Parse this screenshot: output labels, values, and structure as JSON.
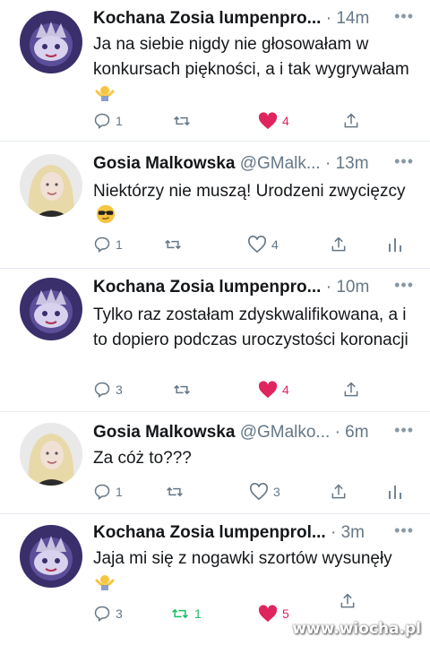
{
  "tweets": [
    {
      "name": "Kochana Zosia lumpenpro...",
      "handle": "",
      "time": "14m",
      "text": "Ja na siebie nigdy nie głosowałam w konkursach piękności, a i tak wygrywałam",
      "emoji": "shrug-emoji",
      "replies": "1",
      "retweets": "",
      "likes": "4",
      "liked": true,
      "avatar": "crowned-cat-avatar"
    },
    {
      "name": "Gosia Malkowska",
      "handle": "@GMalk...",
      "time": "13m",
      "text": "Niektórzy nie muszą! Urodzeni zwycięzcy",
      "emoji": "sunglasses-emoji",
      "replies": "1",
      "retweets": "",
      "likes": "4",
      "liked": false,
      "avatar": "woman-photo-avatar"
    },
    {
      "name": "Kochana Zosia lumpenpro...",
      "handle": "",
      "time": "10m",
      "text": "Tylko raz zostałam zdyskwalifikowana, a i to dopiero podczas uroczystości koronacji",
      "emoji": "",
      "replies": "3",
      "retweets": "",
      "likes": "4",
      "liked": true,
      "avatar": "crowned-cat-avatar"
    },
    {
      "name": "Gosia Malkowska",
      "handle": "@GMalko...",
      "time": "6m",
      "text": "Za cóż to???",
      "emoji": "",
      "replies": "1",
      "retweets": "",
      "likes": "3",
      "liked": false,
      "avatar": "woman-photo-avatar"
    },
    {
      "name": "Kochana Zosia lumpenprol...",
      "handle": "",
      "time": "3m",
      "text": "Jaja mi się z nogawki szortów wysunęły",
      "emoji": "shrug-emoji",
      "replies": "3",
      "retweets": "1",
      "likes": "5",
      "liked": true,
      "avatar": "crowned-cat-avatar"
    }
  ],
  "separator": "·",
  "watermark": "www.wiocha.pl",
  "colors": {
    "like": "#e0245e",
    "retweet": "#17bf63",
    "muted": "#657786",
    "text": "#14171a"
  }
}
